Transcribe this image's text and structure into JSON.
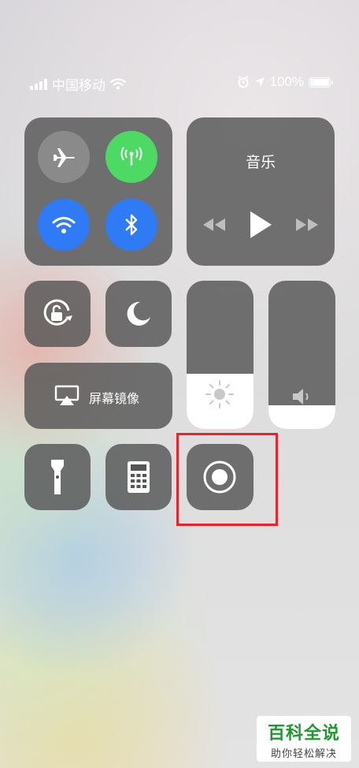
{
  "status_bar": {
    "carrier": "中国移动",
    "battery_percent": "100%"
  },
  "media": {
    "title": "音乐"
  },
  "screen_mirroring": {
    "label": "屏幕镜像"
  },
  "sliders": {
    "brightness_level": 0.37,
    "volume_level": 0.16
  },
  "watermark": {
    "title": "百科全说",
    "subtitle": "助你轻松解决"
  },
  "colors": {
    "cellular_active": "#4cd964",
    "wifi_active": "#2f7af5",
    "bluetooth_active": "#2f7af5",
    "inactive_circle": "#8a8a8a",
    "highlight_box": "#f0202a"
  }
}
